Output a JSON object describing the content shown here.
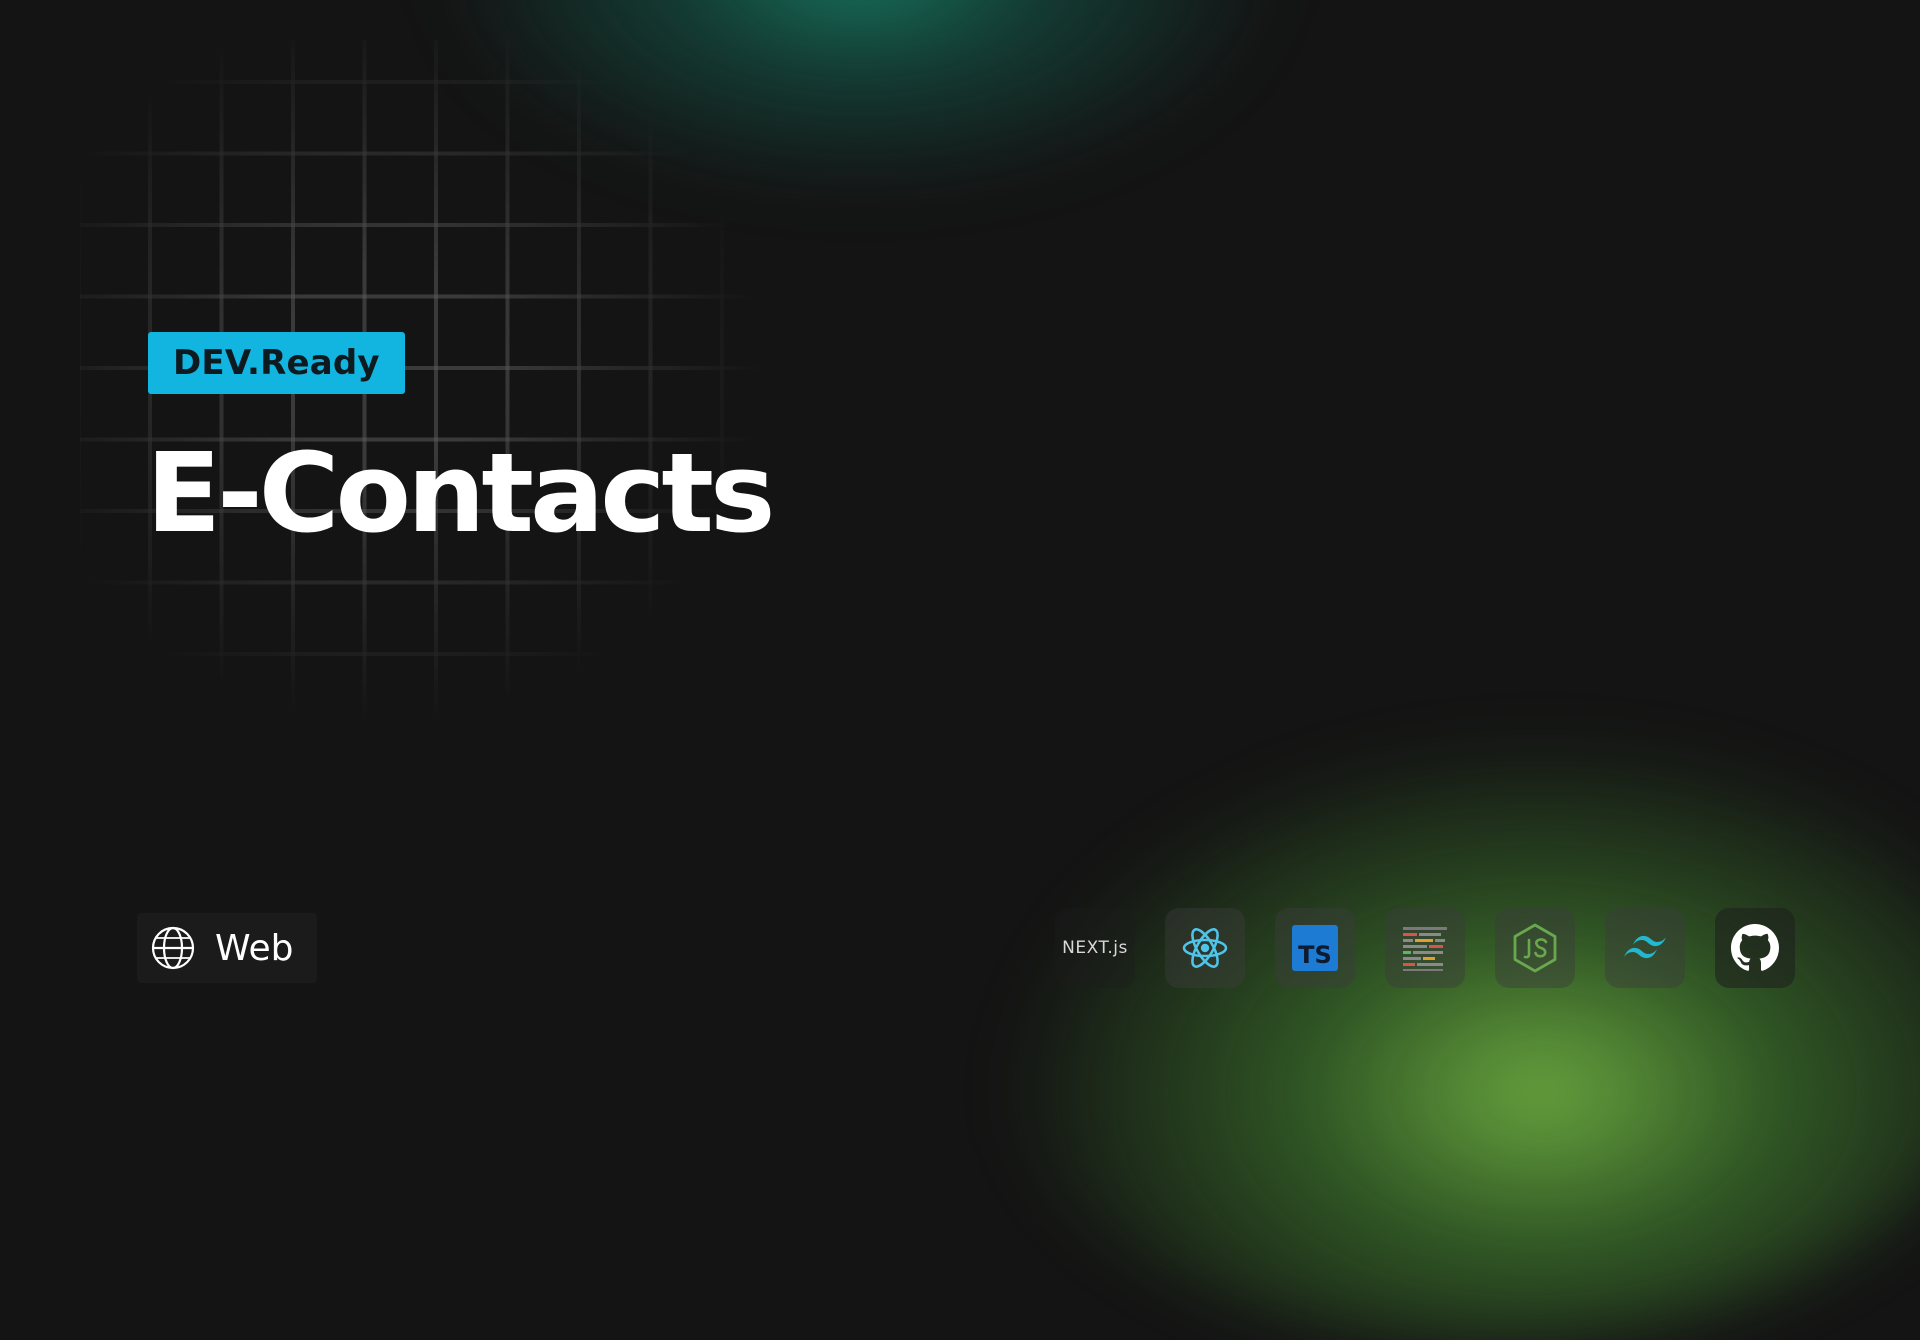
{
  "badge": {
    "text": "DEV.Ready",
    "color": "#12b5e0"
  },
  "project": {
    "title": "E-Contacts"
  },
  "platform": {
    "label": "Web",
    "icon": "globe-icon"
  },
  "tech_stack": [
    {
      "name": "Next.js",
      "icon": "nextjs-icon",
      "text": "NEXT.js"
    },
    {
      "name": "React",
      "icon": "react-icon"
    },
    {
      "name": "TypeScript",
      "icon": "typescript-icon",
      "text": "TS"
    },
    {
      "name": "Code",
      "icon": "code-lines-icon"
    },
    {
      "name": "Node.js",
      "icon": "nodejs-icon"
    },
    {
      "name": "Tailwind CSS",
      "icon": "tailwind-icon"
    },
    {
      "name": "GitHub",
      "icon": "github-icon"
    }
  ],
  "colors": {
    "background": "#141414",
    "glow_top": "#18967a",
    "glow_bottom": "#78be46",
    "react": "#4fc3e8",
    "typescript": "#1d7bd4",
    "node": "#6aa84f",
    "tailwind": "#22b8cf"
  }
}
